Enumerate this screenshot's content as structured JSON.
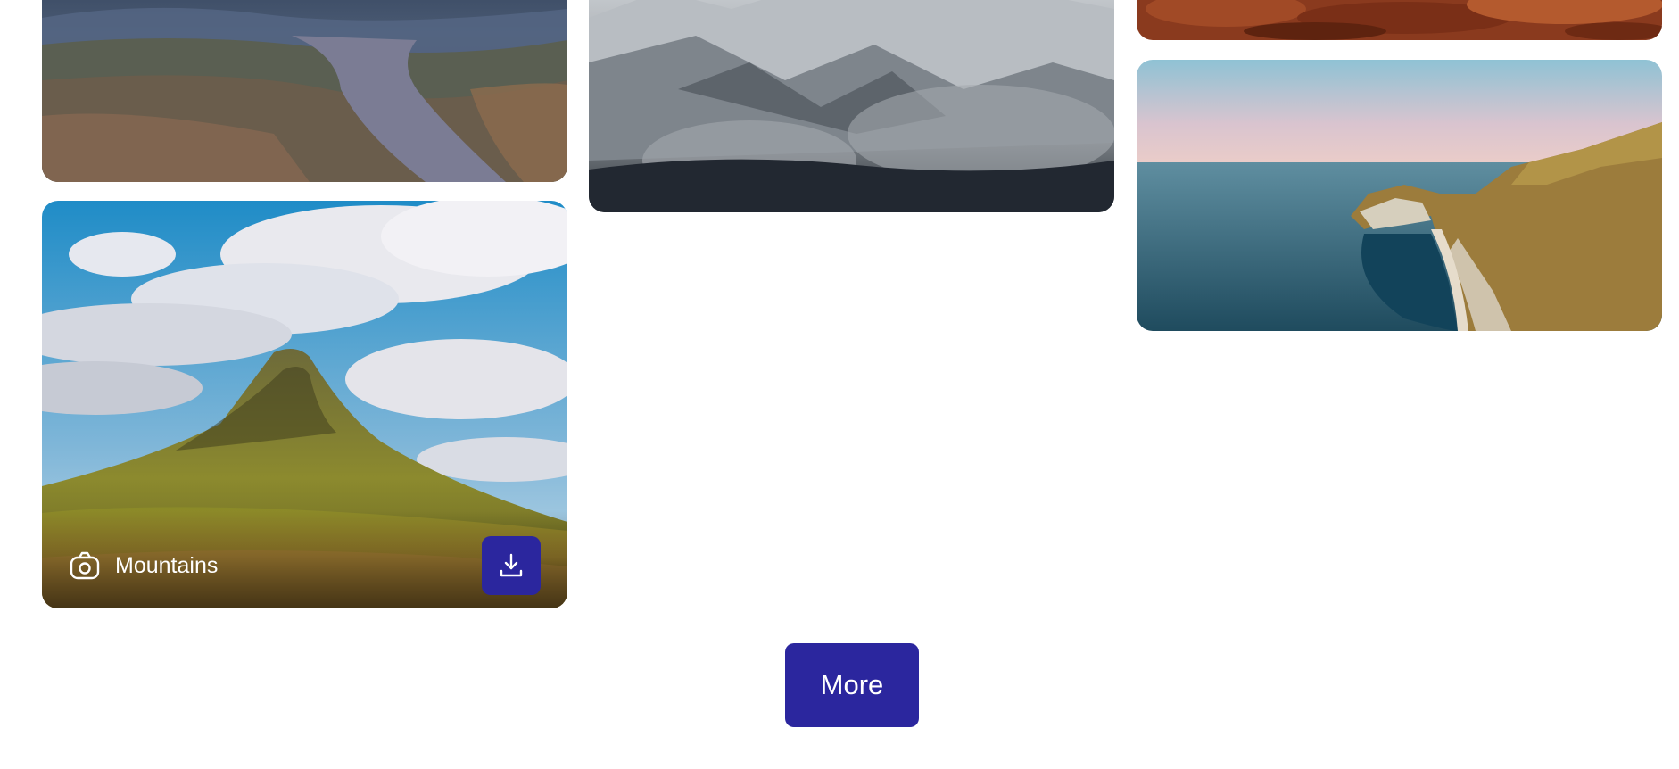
{
  "gallery": {
    "cards": [
      {
        "subject": "path-through-grassland"
      },
      {
        "subject": "kirkjufell-mountain",
        "caption": "Mountains",
        "caption_icon": "camera-icon",
        "action_icon": "download-icon"
      },
      {
        "subject": "snowy-peak-with-clouds"
      },
      {
        "subject": "red-rock-texture"
      },
      {
        "subject": "coastal-cliffs-bay"
      }
    ]
  },
  "more_button": {
    "label": "More"
  },
  "colors": {
    "accent": "#2b269e",
    "background": "#ffffff",
    "caption_text": "#ffffff"
  }
}
